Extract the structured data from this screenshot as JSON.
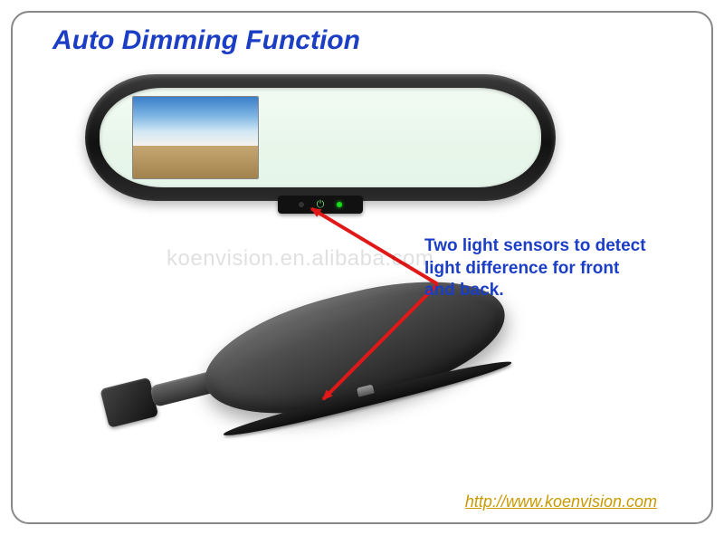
{
  "title": "Auto Dimming Function",
  "annotation": "Two light sensors to detect light difference for front  and back.",
  "watermark": "koenvision.en.alibaba.com",
  "footer": {
    "url_text": "http://www.koenvision.com"
  }
}
